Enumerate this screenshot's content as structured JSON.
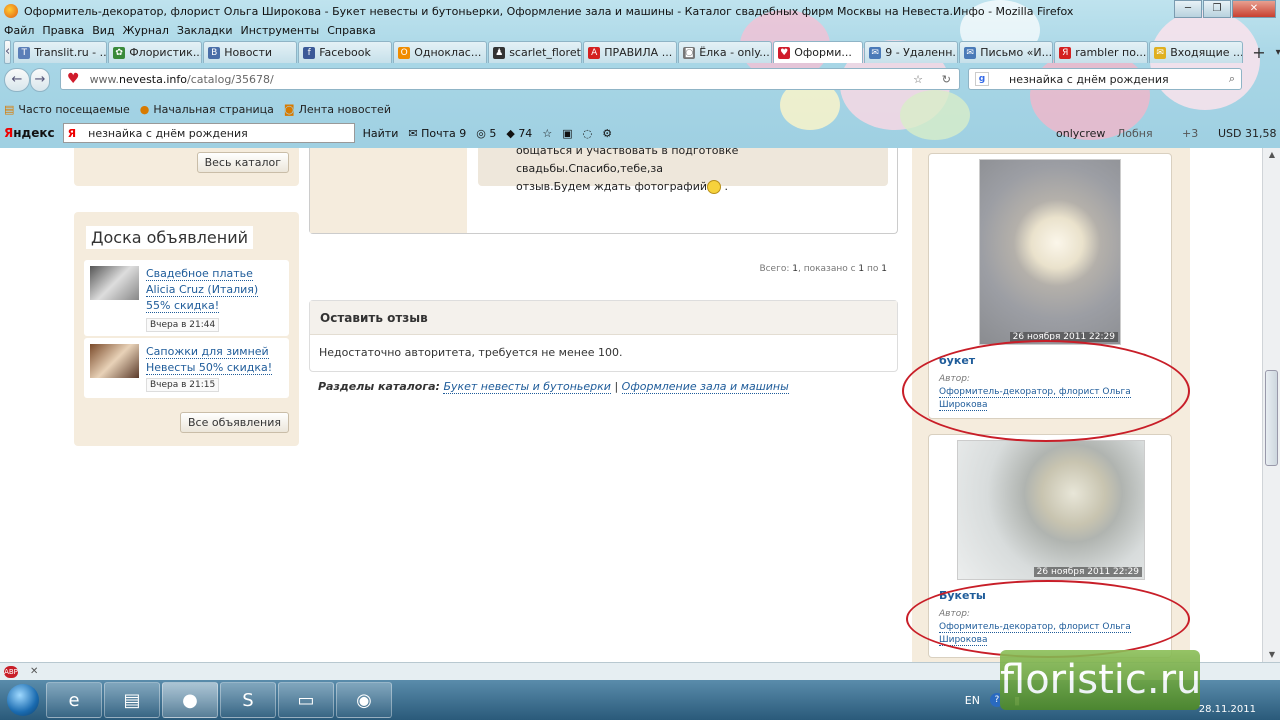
{
  "window": {
    "title": "Оформитель-декоратор, флорист Ольга Широкова - Букет невесты и бутоньерки, Оформление зала и машины - Каталог свадебных фирм Москвы на Невеста.Инфо - Mozilla Firefox"
  },
  "menu": [
    "Файл",
    "Правка",
    "Вид",
    "Журнал",
    "Закладки",
    "Инструменты",
    "Справка"
  ],
  "tabs": [
    {
      "label": "Translit.ru - ...",
      "color": "#5b7fb8",
      "glyph": "T"
    },
    {
      "label": "Флористик...",
      "color": "#3a8a3a",
      "glyph": "✿"
    },
    {
      "label": "Новости",
      "color": "#4a6ea8",
      "glyph": "B"
    },
    {
      "label": "Facebook",
      "color": "#3b5998",
      "glyph": "f"
    },
    {
      "label": "Одноклас...",
      "color": "#f08c00",
      "glyph": "O"
    },
    {
      "label": "scarlet_floret",
      "color": "#333333",
      "glyph": "♟"
    },
    {
      "label": "ПРАВИЛА ...",
      "color": "#d42020",
      "glyph": "A"
    },
    {
      "label": "Ёлка - only...",
      "color": "#777777",
      "glyph": "◙"
    },
    {
      "label": "Оформи...",
      "color": "#d01c2c",
      "glyph": "♥"
    },
    {
      "label": "9 - Удаленн...",
      "color": "#4a7ab8",
      "glyph": "✉"
    },
    {
      "label": "Письмо «И...",
      "color": "#4a7ab8",
      "glyph": "✉"
    },
    {
      "label": "rambler по...",
      "color": "#d42020",
      "glyph": "Я"
    },
    {
      "label": "Входящие ...",
      "color": "#e0b020",
      "glyph": "✉"
    }
  ],
  "address": {
    "prefix": "www.",
    "domain": "nevesta.info",
    "path": "/catalog/35678/"
  },
  "search": {
    "value": "незнайка с днём рождения",
    "engine_icon": "google-icon"
  },
  "bookmarks": [
    "Часто посещаемые",
    "Начальная страница",
    "Лента новостей"
  ],
  "yandex": {
    "logo_first": "Я",
    "logo_rest": "ндекс",
    "query": "незнайка с днём рождения",
    "find": "Найти",
    "mail": "Почта 9",
    "count5": "5",
    "count74": "74",
    "user": "onlycrew",
    "city": "Лобня",
    "weather": "+3",
    "usd": "USD 31,58"
  },
  "page": {
    "all_catalog": "Весь каталог",
    "board_title": "Доска объявлений",
    "ads": [
      {
        "title": "Свадебное платье Alicia Cruz (Италия) 55% скидка!",
        "time": "Вчера в 21:44"
      },
      {
        "title": "Сапожки для зимней Невесты 50% скидка!",
        "time": "Вчера в 21:15"
      }
    ],
    "all_ads": "Все объявления",
    "review_text_1": "общаться и участвовать в подготовке свадьбы.Спасибо,тебе,за",
    "review_text_2": "отзыв.Будем ждать фотографий",
    "counter_prefix": "Всего: ",
    "counter_total": "1",
    "counter_mid": ", показано с ",
    "counter_from": "1",
    "counter_to_word": " по ",
    "counter_to": "1",
    "leave_title": "Оставить отзыв",
    "leave_msg": "Недостаточно авторитета, требуется не менее 100.",
    "sections_label": "Разделы каталога:",
    "section1": "Букет невесты и бутоньерки",
    "section_sep": "|",
    "section2": "Оформление зала и машины",
    "products": [
      {
        "date": "26 ноября 2011 22:29",
        "name": "букет",
        "author_label": "Автор:",
        "author": "Оформитель-декоратор, флорист Ольга Широкова"
      },
      {
        "date": "26 ноября 2011 22:29",
        "name": "Букеты",
        "author_label": "Автор:",
        "author": "Оформитель-декоратор, флорист Ольга Широкова"
      }
    ]
  },
  "taskbar": {
    "lang": "EN",
    "clock_date": "28.11.2011"
  },
  "watermark": "floristic.ru",
  "status": {
    "abp": "ABP"
  }
}
